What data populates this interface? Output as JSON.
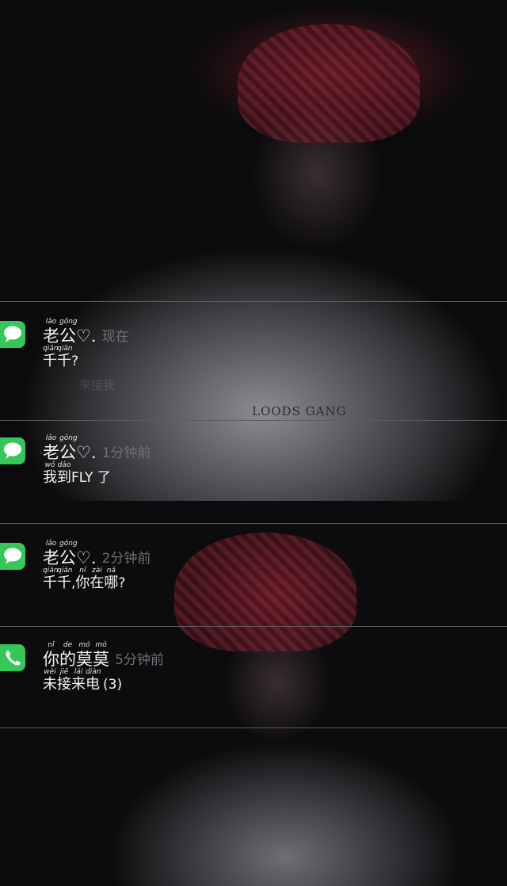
{
  "shirt_print": "LOODS GANG",
  "notifications": [
    {
      "app": "messages",
      "sender_words": [
        {
          "py": "lǎo",
          "hz": "老"
        },
        {
          "py": "gōng",
          "hz": "公"
        }
      ],
      "sender_suffix": "♡.",
      "time": "现在",
      "body_words": [
        {
          "py": "qiān",
          "hz": "千"
        },
        {
          "py": "qiān",
          "hz": "千"
        }
      ],
      "body_suffix": "?",
      "faded_text": "来接我"
    },
    {
      "app": "messages",
      "sender_words": [
        {
          "py": "lǎo",
          "hz": "老"
        },
        {
          "py": "gōng",
          "hz": "公"
        }
      ],
      "sender_suffix": "♡.",
      "time": "1分钟前",
      "body_words": [
        {
          "py": "wǒ",
          "hz": "我"
        },
        {
          "py": "dào",
          "hz": "到"
        }
      ],
      "body_suffix": "FLY 了"
    },
    {
      "app": "messages",
      "sender_words": [
        {
          "py": "lǎo",
          "hz": "老"
        },
        {
          "py": "gōng",
          "hz": "公"
        }
      ],
      "sender_suffix": "♡.",
      "time": "2分钟前",
      "body_words": [
        {
          "py": "qiān",
          "hz": "千"
        },
        {
          "py": "qiān",
          "hz": "千"
        }
      ],
      "body_mid": ",",
      "body_words2": [
        {
          "py": "nǐ",
          "hz": "你"
        },
        {
          "py": "zài",
          "hz": "在"
        },
        {
          "py": "nǎ",
          "hz": "哪"
        }
      ],
      "body_suffix": "?"
    },
    {
      "app": "phone",
      "sender_words": [
        {
          "py": "nǐ",
          "hz": "你"
        },
        {
          "py": "de",
          "hz": "的"
        },
        {
          "py": "mó",
          "hz": "莫"
        },
        {
          "py": "mó",
          "hz": "莫"
        }
      ],
      "sender_suffix": "",
      "time": "5分钟前",
      "body_words": [
        {
          "py": "wèi",
          "hz": "未"
        },
        {
          "py": "jiē",
          "hz": "接"
        },
        {
          "py": "lái",
          "hz": "来"
        },
        {
          "py": "diàn",
          "hz": "电"
        }
      ],
      "body_suffix": "(3)"
    }
  ]
}
